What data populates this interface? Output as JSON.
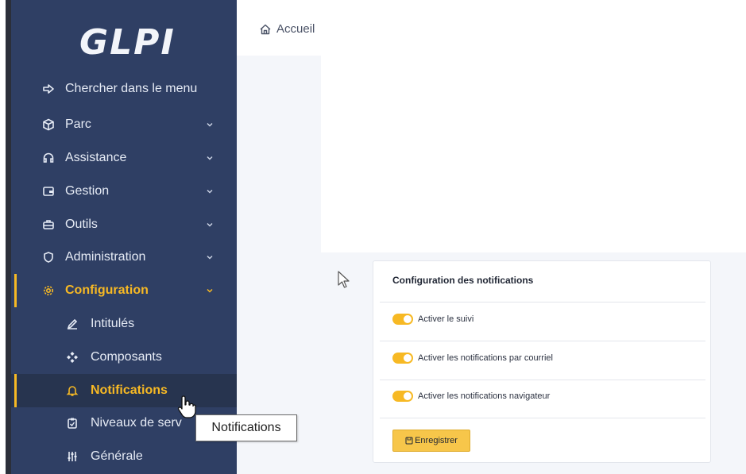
{
  "app": {
    "logo": "GLPI"
  },
  "breadcrumb": {
    "home_label": "Accueil"
  },
  "sidebar": {
    "search_label": "Chercher dans le menu",
    "items": [
      {
        "label": "Parc",
        "icon": "cube-icon"
      },
      {
        "label": "Assistance",
        "icon": "headset-icon"
      },
      {
        "label": "Gestion",
        "icon": "wallet-icon"
      },
      {
        "label": "Outils",
        "icon": "briefcase-icon"
      },
      {
        "label": "Administration",
        "icon": "shield-icon"
      },
      {
        "label": "Configuration",
        "icon": "gear-icon",
        "active": true
      }
    ],
    "subitems": [
      {
        "label": "Intitulés",
        "icon": "edit-icon"
      },
      {
        "label": "Composants",
        "icon": "components-icon"
      },
      {
        "label": "Notifications",
        "icon": "bell-icon",
        "selected": true
      },
      {
        "label": "Niveaux de serv",
        "icon": "clipboard-icon"
      },
      {
        "label": "Générale",
        "icon": "sliders-icon"
      }
    ]
  },
  "card": {
    "title": "Configuration des notifications",
    "toggles": [
      {
        "label": "Activer le suivi",
        "on": true
      },
      {
        "label": "Activer les notifications par courriel",
        "on": true
      },
      {
        "label": "Activer les notifications navigateur",
        "on": true
      }
    ],
    "save_label": "Enregistrer"
  },
  "tooltip": {
    "text": "Notifications"
  },
  "colors": {
    "sidebar": "#2f3f64",
    "accent": "#f7b924",
    "background": "#f4f6fa"
  }
}
